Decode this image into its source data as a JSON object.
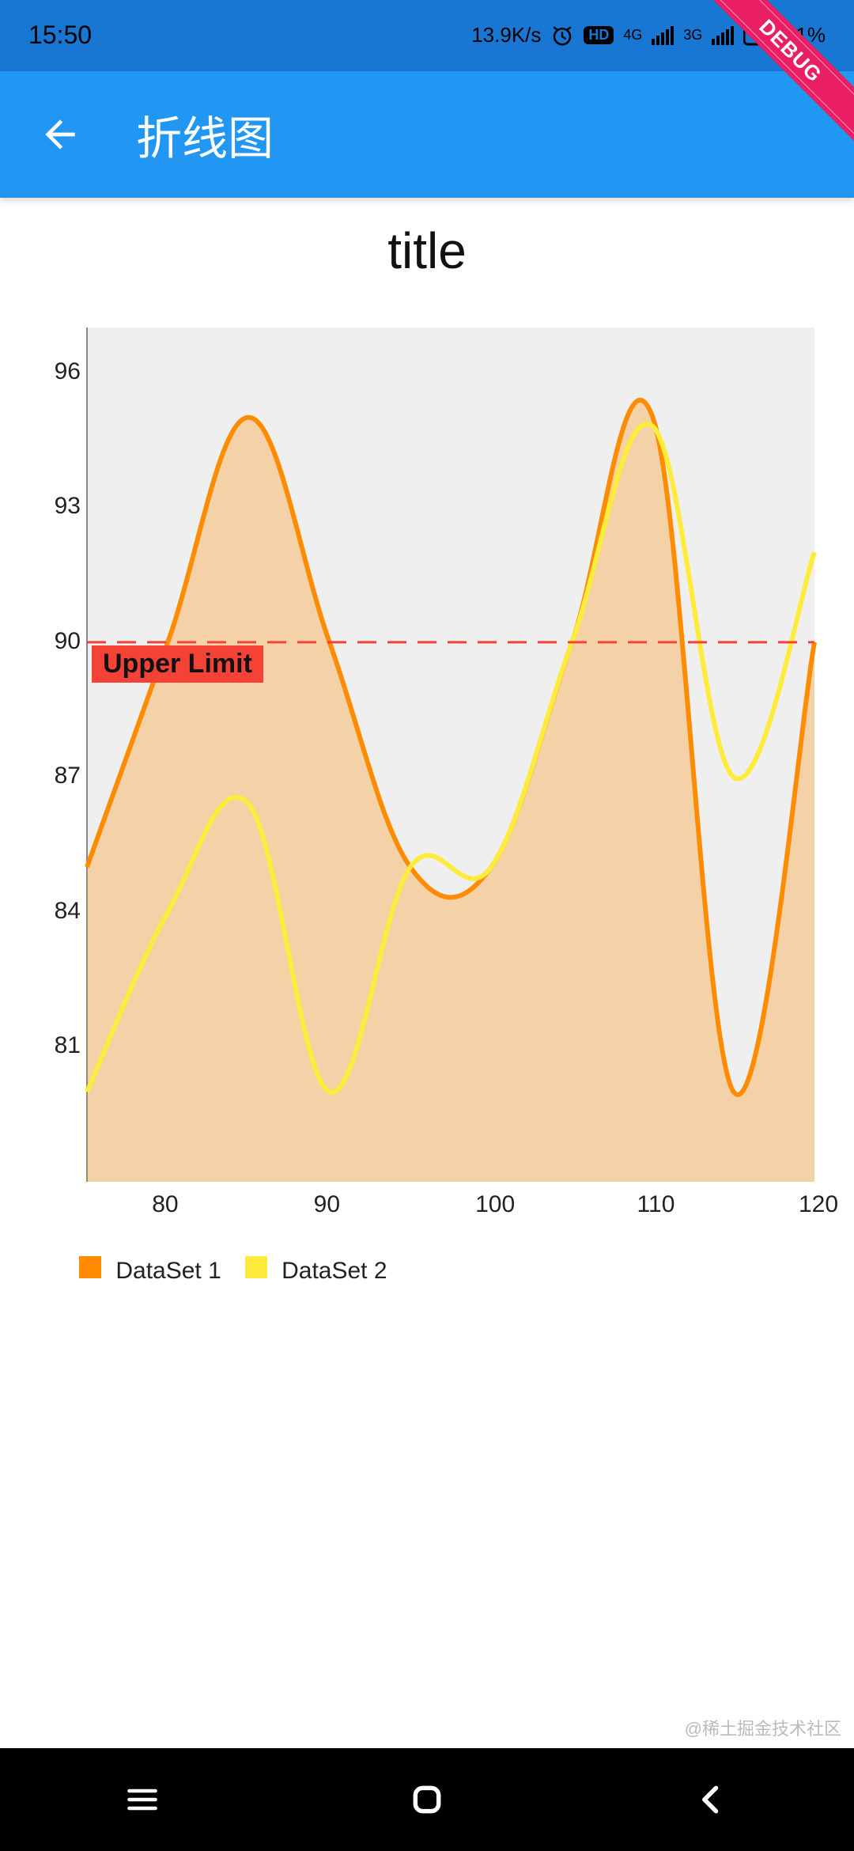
{
  "status_bar": {
    "time": "15:50",
    "net_speed": "13.9K/s",
    "alarm_icon": "alarm-icon",
    "hd_badge": "HD",
    "signal1_label": "4G",
    "signal2_label": "3G",
    "battery_percent": "1%"
  },
  "debug_ribbon": "DEBUG",
  "app_bar": {
    "back_icon": "back-arrow",
    "title": "折线图"
  },
  "chart_title": "title",
  "legend": {
    "items": [
      {
        "label": "DataSet 1",
        "color": "#FF8C00"
      },
      {
        "label": "DataSet 2",
        "color": "#FFEB3B"
      }
    ]
  },
  "limit_line": {
    "label": "Upper Limit",
    "value": 90,
    "color": "#F44336"
  },
  "watermark": "@稀土掘金技术社区",
  "nav": {
    "recent": "recent",
    "home": "home",
    "back": "back"
  },
  "chart_data": {
    "type": "line",
    "title": "title",
    "xlabel": "",
    "ylabel": "",
    "xlim": [
      75,
      120
    ],
    "ylim": [
      78,
      97
    ],
    "x_ticks": [
      80,
      90,
      100,
      110,
      120
    ],
    "y_ticks": [
      81,
      84,
      87,
      90,
      93,
      96
    ],
    "grid": false,
    "limit_lines": [
      {
        "label": "Upper Limit",
        "value": 90,
        "axis": "y",
        "style": "dashed",
        "color": "#F44336"
      }
    ],
    "series": [
      {
        "name": "DataSet 1",
        "color": "#FF8C00",
        "fill": "rgba(255,140,0,0.30)",
        "x": [
          75,
          80,
          85,
          90,
          95,
          100,
          105,
          110,
          115,
          120
        ],
        "values": [
          85,
          90,
          95,
          90,
          85,
          85,
          90,
          95,
          80,
          90
        ]
      },
      {
        "name": "DataSet 2",
        "color": "#FFEB3B",
        "fill": null,
        "x": [
          75,
          80,
          85,
          90,
          95,
          100,
          105,
          110,
          115,
          120
        ],
        "values": [
          80,
          84,
          86.4,
          80,
          85,
          85,
          90,
          94.8,
          87,
          92
        ]
      }
    ]
  }
}
